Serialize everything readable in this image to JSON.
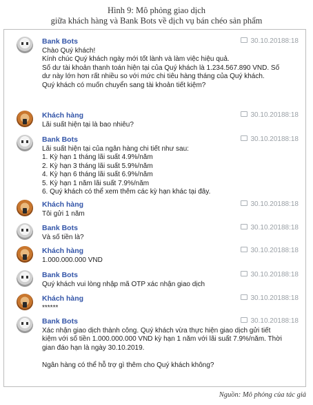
{
  "caption": {
    "line1": "Hình 9: Mô phỏng giao dịch",
    "line2": "giữa khách hàng và Bank Bots về dịch vụ bán chéo sản phẩm"
  },
  "messages": [
    {
      "sender": "Bank Bots",
      "avatar": "robot-avatar-icon",
      "time": "30.10.20188:18",
      "text": "Chào Quý khách!\nKính chúc Quý khách ngày mới tốt lành và làm việc hiệu quả.\nSố dư tài khoản thanh toán hiện tại của Quý khách là 1.234.567.890 VND. Số dư này lớn hơn rất nhiều so với mức chi tiêu hàng tháng của Quý khách.\nQuý khách có muốn chuyển sang tài khoản tiết kiệm?"
    },
    {
      "sender": "Khách hàng",
      "avatar": "customer-avatar-icon",
      "time": "30.10.20188:18",
      "text": "Lãi suất hiện tại là bao nhiêu?"
    },
    {
      "sender": "Bank Bots",
      "avatar": "robot-avatar-icon",
      "time": "30.10.20188:18",
      "text": "Lãi suất hiện tại của ngân hàng chi tiết như sau:\n1. Kỳ hạn 1 tháng lãi suất 4.9%/năm\n2. Kỳ hạn 3 tháng lãi suất 5.9%/năm\n4. Kỳ hạn 6 tháng lãi suất 6.9%/năm\n5. Kỳ hạn 1 năm lãi suất 7.9%/năm\n6. Quý khách có thể xem thêm các kỳ hạn khác tại đây."
    },
    {
      "sender": "Khách hàng",
      "avatar": "customer-avatar-icon",
      "time": "30.10.20188:18",
      "text": "Tôi gửi 1 năm"
    },
    {
      "sender": "Bank Bots",
      "avatar": "robot-avatar-icon",
      "time": "30.10.20188:18",
      "text": "Và số tiền là?"
    },
    {
      "sender": "Khách hàng",
      "avatar": "customer-avatar-icon",
      "time": "30.10.20188:18",
      "text": "1.000.000.000 VND"
    },
    {
      "sender": "Bank Bots",
      "avatar": "robot-avatar-icon",
      "time": "30.10.20188:18",
      "text": "Quý khách vui lòng nhập mã OTP xác nhận giao dịch"
    },
    {
      "sender": "Khách hàng",
      "avatar": "customer-avatar-icon",
      "time": "30.10.20188:18",
      "text": "******"
    },
    {
      "sender": "Bank Bots",
      "avatar": "robot-avatar-icon",
      "time": "30.10.20188:18",
      "text": "Xác nhận giao dịch thành công. Quý khách vừa thực hiện giao dịch gửi tiết kiệm với số tiền 1.000.000.000 VND kỳ hạn 1 năm với lãi suất 7.9%/năm. Thời gian đáo hạn là ngày 30.10.2019.\n\nNgân hàng có thể hỗ trợ gì thêm cho Quý khách không?"
    }
  ],
  "source": "Nguồn: Mô phỏng của tác giả"
}
